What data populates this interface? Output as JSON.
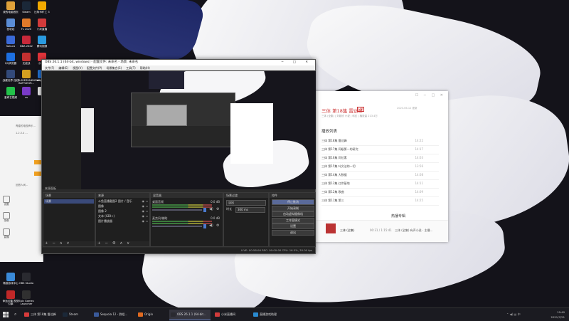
{
  "desktop_icons": [
    {
      "label": "我的电脑首页",
      "color": "#e0a13a"
    },
    {
      "label": "Steam",
      "color": "#1b2838"
    },
    {
      "label": "比特币矿工 3",
      "color": "#f2a900"
    },
    {
      "label": "回收站",
      "color": "#5b8dd6"
    },
    {
      "label": "FL 2020",
      "color": "#e07a2a"
    },
    {
      "label": "小米直播",
      "color": "#d23b3b"
    },
    {
      "label": "Sakura",
      "color": "#3a6ad8"
    },
    {
      "label": "NBA 2K22",
      "color": "#c8293a"
    },
    {
      "label": "腾讯视频",
      "color": "#2a9ae0"
    },
    {
      "label": "QQ浏览器",
      "color": "#1d6fe0"
    },
    {
      "label": "无敌战",
      "color": "#c23030"
    },
    {
      "label": "小红书",
      "color": "#e0343a"
    },
    {
      "label": "战舰世界 连线",
      "color": "#334a7a"
    },
    {
      "label": "PLAYERUNKNOWN'S BATTLEGR...",
      "color": "#d4a020"
    },
    {
      "label": "wegame",
      "color": "#2070d0"
    },
    {
      "label": "爱奇艺视频",
      "color": "#23c24a"
    },
    {
      "label": "vs",
      "color": "#7a3ac8"
    },
    {
      "label": "",
      "color": "#e8e8e8"
    },
    {
      "label": "畅游游戏中心",
      "color": "#3a8ad8"
    },
    {
      "label": "OBS Studio",
      "color": "#2a2a30"
    },
    {
      "label": "命运引擎 视觉引擎",
      "color": "#c02828"
    },
    {
      "label": "Epic Games Launcher",
      "color": "#303030"
    }
  ],
  "left_app": {
    "texts": [
      "青春的电视声乐...",
      "1.2.3.4 ...",
      "回首人间...",
      "..."
    ],
    "items": [
      "设置",
      "录像",
      "直播"
    ]
  },
  "music_app": {
    "window_controls": "☐ ─ □ ✕",
    "title": "三体 第18集 雷达峰",
    "badge": "VIP",
    "subtitle": "三体 (全集) | 刘慈欣 小说 | 科幻 | 播放量 213.4万",
    "side_label": "2020-06-12 更新",
    "heading": "播放列表",
    "rows": [
      {
        "name": "三体 第18集 雷达峰",
        "time": "14:22"
      },
      {
        "name": "三体 第17集 同级第一的研究",
        "time": "14:17"
      },
      {
        "name": "三体 第16集 同位素",
        "time": "14:03"
      },
      {
        "name": "三体 第15集 叶文洁的一切",
        "time": "13:56"
      },
      {
        "name": "三体 第14集 大数据",
        "time": "14:08"
      },
      {
        "name": "三体 第13集 红岸基地",
        "time": "14:11"
      },
      {
        "name": "三体 第12集 歌曲",
        "time": "14:09"
      },
      {
        "name": "三体 第11集 第三",
        "time": "14:25"
      }
    ],
    "hot_label": "热播专辑",
    "footer": {
      "track": "三体 (全集)",
      "time": "00:31 / 1:15:41",
      "artist": "三体 (全集) 有声小说 · 主播..."
    }
  },
  "obs": {
    "title": "OBS 26.1.1 (64-bit, windows) - 配置文件: 未命名 - 场景: 未命名",
    "window_controls": "─ □ ✕",
    "menu": [
      "文件(F)",
      "编辑(E)",
      "视图(V)",
      "配置文件(P)",
      "场景集合(S)",
      "工具(T)",
      "帮助(H)"
    ],
    "dock_label": "来源面板",
    "scenes": {
      "header": "场景",
      "items": [
        "场景"
      ],
      "footer": "+ − ∧ ∨"
    },
    "sources": {
      "header": "来源",
      "items": [
        "斗鱼直播截图2 图片 / 音乐",
        "图像",
        "图像 2",
        "文本 (GDI+)",
        "图片播放器"
      ],
      "footer": "+ − ⚙ ∧ ∨"
    },
    "mixer": {
      "header": "混音器",
      "channels": [
        {
          "name": "桌面音频",
          "db": "0.0 dB"
        },
        {
          "name": "麦克风/辅助",
          "db": "0.0 dB"
        }
      ]
    },
    "transitions": {
      "header": "场景过渡",
      "selected": "淡出",
      "duration_label": "时长",
      "duration": "300 ms"
    },
    "controls": {
      "header": "控件",
      "buttons": [
        "停止推流",
        "开始录制",
        "启动虚拟摄像机",
        "工作室模式",
        "设置",
        "退出"
      ]
    },
    "status": "LIVE: 00:58:06    REC: 00:00:00    CPU: 16.5%, 30.00 fps"
  },
  "taskbar": {
    "search_icon": "search-icon",
    "items": [
      {
        "label": "三体 第18集 雷达峰",
        "color": "#d83b3b",
        "active": false
      },
      {
        "label": "Steam",
        "color": "#1b2838",
        "active": false
      },
      {
        "label": "Sequoia 12 - 群组...",
        "color": "#3a5a9a",
        "active": false
      },
      {
        "label": "Origin",
        "color": "#e06a20",
        "active": false
      },
      {
        "label": "OBS 26.1.1 (64-bit...",
        "color": "#2a2a30",
        "active": true
      },
      {
        "label": "小米直播间",
        "color": "#d23b3b",
        "active": false
      },
      {
        "label": "直播游戏助理",
        "color": "#2a8ad0",
        "active": false
      }
    ],
    "tray": {
      "time": "19:40",
      "date": "2021/7/21"
    }
  }
}
